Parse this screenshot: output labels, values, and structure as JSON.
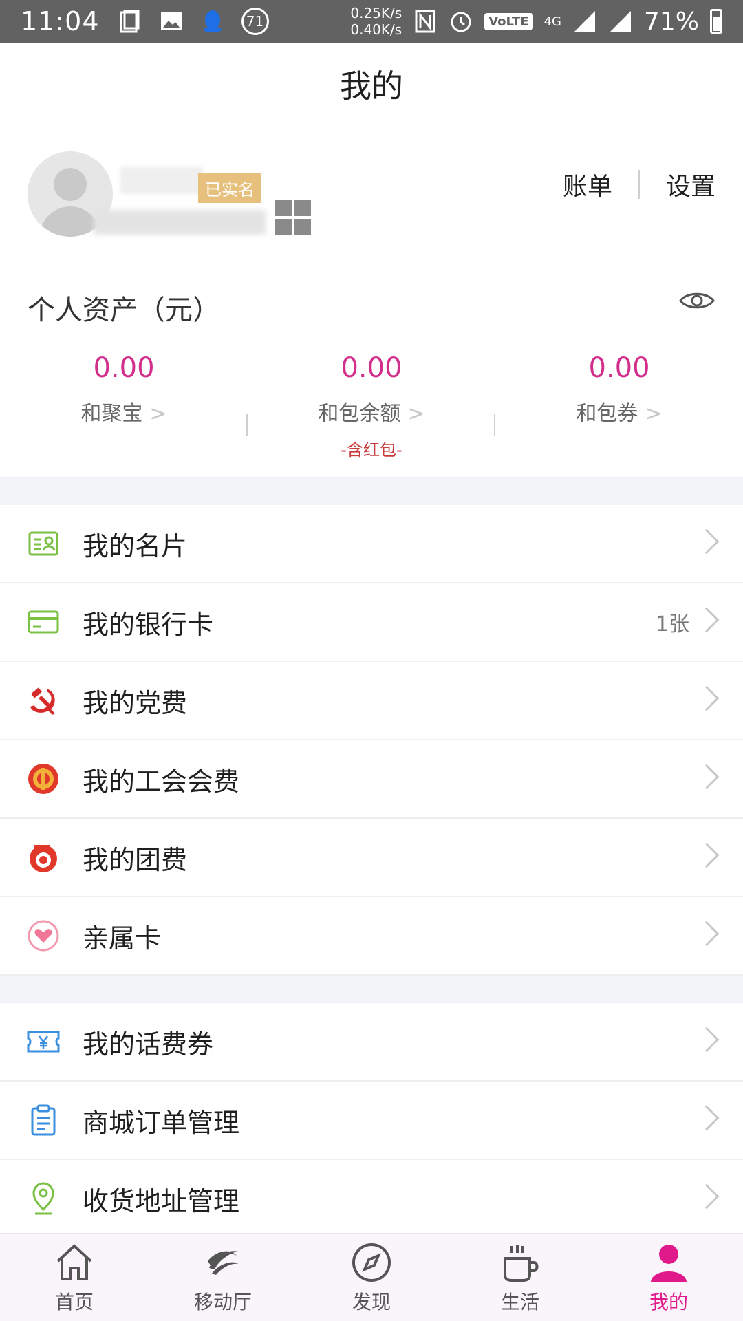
{
  "status_bar": {
    "time": "11:04",
    "notification_count": "71",
    "speed_up": "0.25K/s",
    "speed_down": "0.40K/s",
    "volte": "VoLTE",
    "network": "4G",
    "battery": "71%"
  },
  "header": {
    "title": "我的"
  },
  "profile": {
    "verified_badge": "已实名",
    "bill_label": "账单",
    "settings_label": "设置"
  },
  "assets": {
    "title": "个人资产（元）",
    "items": [
      {
        "value": "0.00",
        "label": "和聚宝",
        "arrow": ">"
      },
      {
        "value": "0.00",
        "label": "和包余额",
        "arrow": ">",
        "note": "-含红包-"
      },
      {
        "value": "0.00",
        "label": "和包券",
        "arrow": ">"
      }
    ]
  },
  "list_group_1": [
    {
      "label": "我的名片",
      "icon": "card-icon"
    },
    {
      "label": "我的银行卡",
      "icon": "bank-card-icon",
      "extra": "1张"
    },
    {
      "label": "我的党费",
      "icon": "party-icon"
    },
    {
      "label": "我的工会会费",
      "icon": "union-icon"
    },
    {
      "label": "我的团费",
      "icon": "league-icon"
    },
    {
      "label": "亲属卡",
      "icon": "heart-icon"
    }
  ],
  "list_group_2": [
    {
      "label": "我的话费券",
      "icon": "voucher-icon"
    },
    {
      "label": "商城订单管理",
      "icon": "clipboard-icon"
    },
    {
      "label": "收货地址管理",
      "icon": "location-icon"
    }
  ],
  "tabbar": [
    {
      "label": "首页",
      "icon": "home-icon"
    },
    {
      "label": "移动厅",
      "icon": "china-mobile-icon"
    },
    {
      "label": "发现",
      "icon": "compass-icon"
    },
    {
      "label": "生活",
      "icon": "cup-icon"
    },
    {
      "label": "我的",
      "icon": "user-icon",
      "active": true
    }
  ],
  "colors": {
    "accent": "#e01a8a",
    "value": "#d22f8c",
    "verified": "#e7c07d"
  }
}
